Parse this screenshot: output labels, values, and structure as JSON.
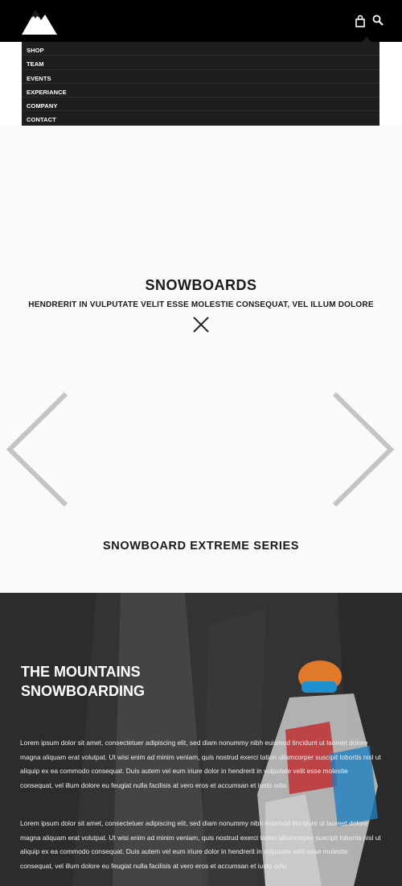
{
  "header": {
    "logo_icon": "mountain-logo-icon",
    "cart_icon": "shopping-bag-icon",
    "search_icon": "search-icon"
  },
  "menu": {
    "items": [
      {
        "label": "SHOP"
      },
      {
        "label": "TEAM"
      },
      {
        "label": "EVENTS"
      },
      {
        "label": "EXPERIANCE"
      },
      {
        "label": "COMPANY"
      },
      {
        "label": "CONTACT"
      }
    ]
  },
  "hero": {
    "title": "SNOWBOARDS",
    "subtitle": "HENDRERIT IN VULPUTATE VELIT ESSE MOLESTIE CONSEQUAT, VEL ILLUM DOLORE",
    "caption": "SNOWBOARD EXTREME SERIES",
    "prev_icon": "chevron-left-icon",
    "next_icon": "chevron-right-icon",
    "close_icon": "close-icon"
  },
  "section": {
    "title_line1": "THE MOUNTAINS",
    "title_line2": "SNOWBOARDING",
    "paragraph1": "Lorem ipsum dolor sit amet, consectetuer adipiscing elit, sed diam nonummy nibh euismod tincidunt ut laoreet dolore magna aliquam erat volutpat. Ut wisi enim ad minim veniam, quis nostrud exerci tation ullamcorper suscipit lobortis nisl ut aliquip ex ea commodo consequat. Duis autem vel eum iriure dolor in hendrerit in vulputate velit esse molestie consequat, vel illum dolore eu feugiat nulla facilisis at vero eros et accumsan et iusto odio",
    "paragraph2": "Lorem ipsum dolor sit amet, consectetuer adipiscing elit, sed diam nonummy nibh euismod tincidunt ut laoreet dolore magna aliquam erat volutpat. Ut wisi enim ad minim veniam, quis nostrud exerci tation ullamcorper suscipit lobortis nisl ut aliquip ex ea commodo consequat. Duis autem vel eum iriure dolor in hendrerit in vulputate velit esse molestie consequat, vel illum dolore eu feugiat nulla facilisis at vero eros et accumsan et iusto odio"
  },
  "colors": {
    "header_bg": "#000000",
    "menu_bg": "#1e1e1e",
    "text_dark": "#1a1a1a",
    "text_light": "#ffffff"
  }
}
